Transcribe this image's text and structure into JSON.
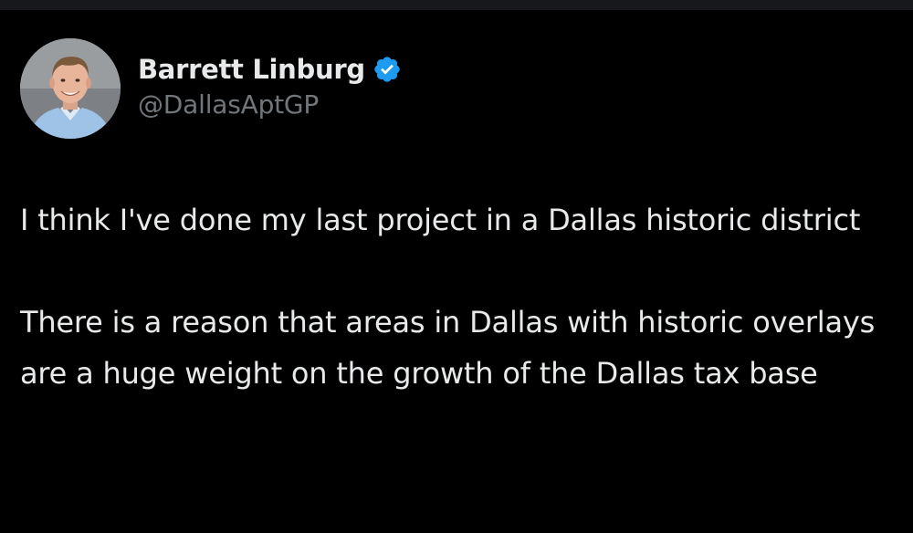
{
  "author": {
    "display_name": "Barrett Linburg",
    "handle": "@DallasAptGP",
    "verified": true,
    "verified_color": "#1d9bf0",
    "avatar_icon": "profile-photo"
  },
  "tweet": {
    "paragraphs": [
      "I think I've done my last project in a Dallas historic district",
      "There is a reason that areas in Dallas with historic overlays are a huge weight on the growth of the Dallas tax base"
    ]
  },
  "theme": {
    "background": "#000000",
    "text": "#e7e9ea",
    "secondary_text": "#71767b"
  }
}
